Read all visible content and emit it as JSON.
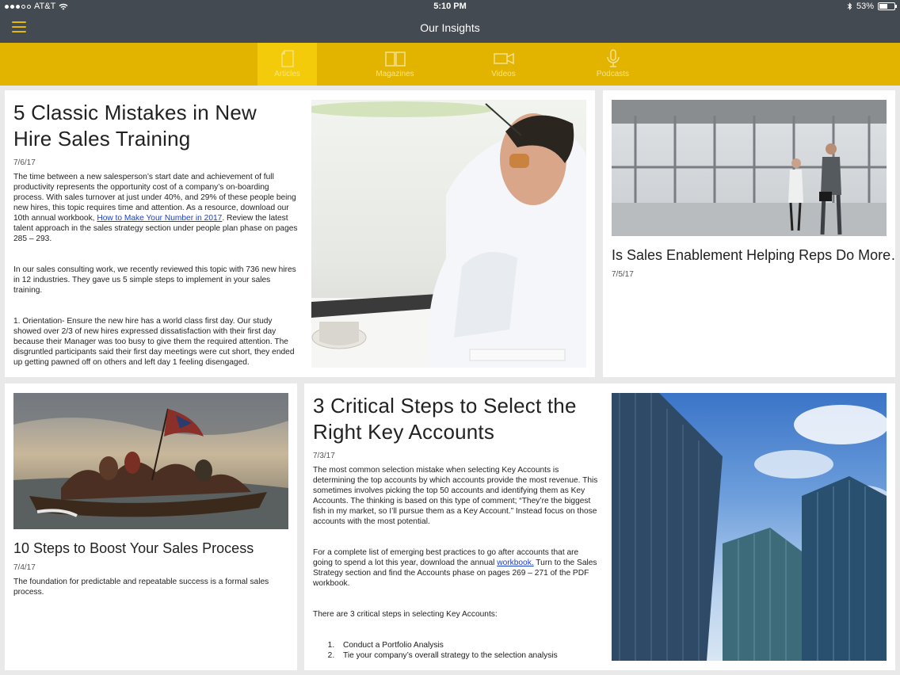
{
  "status": {
    "carrier": "AT&T",
    "time": "5:10 PM",
    "battery": "53%"
  },
  "nav": {
    "title": "Our Insights"
  },
  "tabs": [
    {
      "label": "Articles",
      "icon": "document-icon",
      "active": true
    },
    {
      "label": "Magazines",
      "icon": "open-book-icon",
      "active": false
    },
    {
      "label": "Videos",
      "icon": "video-camera-icon",
      "active": false
    },
    {
      "label": "Podcasts",
      "icon": "microphone-icon",
      "active": false
    }
  ],
  "articles": [
    {
      "title": "5 Classic Mistakes in New Hire Sales Training",
      "date": "7/6/17",
      "p1_before": "The time between a new salesperson’s start date and achievement of full productivity represents the opportunity cost of a company’s on-boarding process. With sales turnover at just under 40%, and 29% of these people being new hires, this topic requires time and attention. As a resource, download our 10th annual workbook, ",
      "p1_link": "How to Make Your Number in 2017",
      "p1_after": ". Review the latest talent approach in the sales strategy section under people plan phase on pages 285 – 293.",
      "p2": "In our sales consulting work, we recently reviewed this topic with 736 new hires in 12 industries. They gave us 5 simple steps to implement in your sales training.",
      "p3": "1. Orientation- Ensure the new hire has a world class first day. Our study showed over 2/3 of new hires expressed dissatisfaction with their first day because their Manager was too busy to give them the required attention. The disgruntled participants said their first day meetings were cut short, they ended up getting pawned off on others and left day 1 feeling disengaged."
    },
    {
      "title": "Is Sales Enablement Helping Reps Do More…",
      "date": "7/5/17"
    },
    {
      "title": "10 Steps to Boost Your Sales Process",
      "date": "7/4/17",
      "p1": "The foundation for predictable and repeatable success is a formal sales process."
    },
    {
      "title": "3 Critical Steps to Select the Right Key Accounts",
      "date": "7/3/17",
      "p1": "The most common selection mistake when selecting Key Accounts is determining the top accounts by which accounts provide the most revenue. This sometimes involves picking the top 50 accounts and identifying them as Key Accounts.  The thinking is based on this type of comment; “They’re the biggest fish in my market, so I’ll pursue them as a Key Account.” Instead focus on those accounts with the most potential.",
      "p2_before": "For a complete list of emerging best practices to go after accounts that are going to spend a lot this year, download the annual ",
      "p2_link": "workbook.",
      "p2_after": " Turn to the Sales Strategy section and find the Accounts phase on pages 269 – 271 of the PDF workbook.",
      "p3": "There are 3 critical steps in selecting Key Accounts:",
      "steps": [
        "Conduct a Portfolio Analysis",
        "Tie your company’s overall strategy to the selection analysis"
      ]
    }
  ]
}
